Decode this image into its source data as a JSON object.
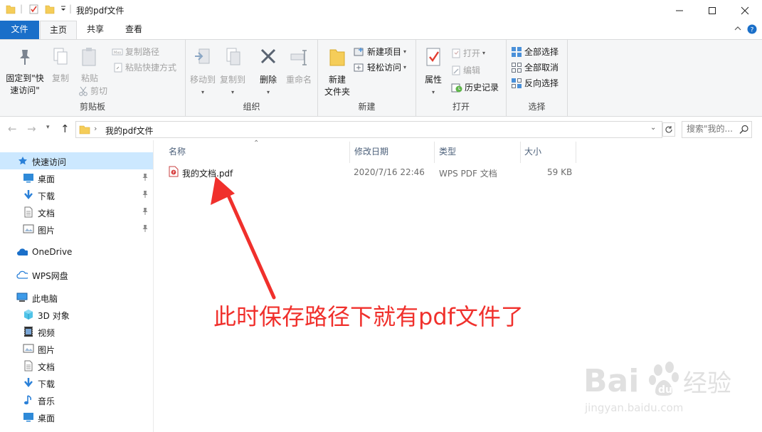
{
  "window": {
    "title": "我的pdf文件",
    "controls": [
      "minimize-icon",
      "maximize-icon",
      "close-icon"
    ]
  },
  "tabs": [
    {
      "label": "文件",
      "active": false
    },
    {
      "label": "主页",
      "active": true
    },
    {
      "label": "共享",
      "active": false
    },
    {
      "label": "查看",
      "active": false
    }
  ],
  "ribbon": {
    "clipboard": {
      "group_label": "剪贴板",
      "pin_quick_line1": "固定到\"快",
      "pin_quick_line2": "速访问\"",
      "copy": "复制",
      "paste": "粘贴",
      "copy_path": "复制路径",
      "paste_shortcut": "粘贴快捷方式",
      "cut": "剪切"
    },
    "organize": {
      "group_label": "组织",
      "move_to": "移动到",
      "copy_to": "复制到",
      "delete": "删除",
      "rename": "重命名"
    },
    "new": {
      "group_label": "新建",
      "new_folder_line1": "新建",
      "new_folder_line2": "文件夹",
      "new_item": "新建项目",
      "easy_access": "轻松访问"
    },
    "open": {
      "group_label": "打开",
      "properties": "属性",
      "open": "打开",
      "edit": "编辑",
      "history": "历史记录"
    },
    "select": {
      "group_label": "选择",
      "select_all": "全部选择",
      "select_none": "全部取消",
      "invert": "反向选择"
    }
  },
  "address": {
    "path": "我的pdf文件",
    "search_placeholder": "搜索\"我的..."
  },
  "sidebar": {
    "quick_access": "快速访问",
    "quick_items": [
      {
        "label": "桌面",
        "icon": "desktop-icon"
      },
      {
        "label": "下载",
        "icon": "download-icon"
      },
      {
        "label": "文档",
        "icon": "document-icon"
      },
      {
        "label": "图片",
        "icon": "picture-icon"
      }
    ],
    "onedrive": "OneDrive",
    "wps_cloud": "WPS网盘",
    "this_pc": "此电脑",
    "pc_items": [
      {
        "label": "3D 对象",
        "icon": "3d-objects-icon"
      },
      {
        "label": "视频",
        "icon": "video-icon"
      },
      {
        "label": "图片",
        "icon": "picture-icon"
      },
      {
        "label": "文档",
        "icon": "document-icon"
      },
      {
        "label": "下载",
        "icon": "download-icon"
      },
      {
        "label": "音乐",
        "icon": "music-icon"
      },
      {
        "label": "桌面",
        "icon": "desktop-icon"
      }
    ]
  },
  "filelist": {
    "columns": [
      "名称",
      "修改日期",
      "类型",
      "大小"
    ],
    "rows": [
      {
        "name": "我的文档.pdf",
        "modified": "2020/7/16 22:46",
        "type": "WPS PDF 文档",
        "size": "59 KB"
      }
    ]
  },
  "annotation": {
    "text": "此时保存路径下就有pdf文件了",
    "color": "#f0302c"
  },
  "watermark": {
    "brand": "Bai",
    "brand2": "du",
    "cn": "经验",
    "url": "jingyan.baidu.com"
  },
  "colors": {
    "accent": "#1a6fc9",
    "ribbon_bg": "#f5f6f7",
    "selected_bg": "#cce8ff",
    "folder": "#f5cd59"
  }
}
